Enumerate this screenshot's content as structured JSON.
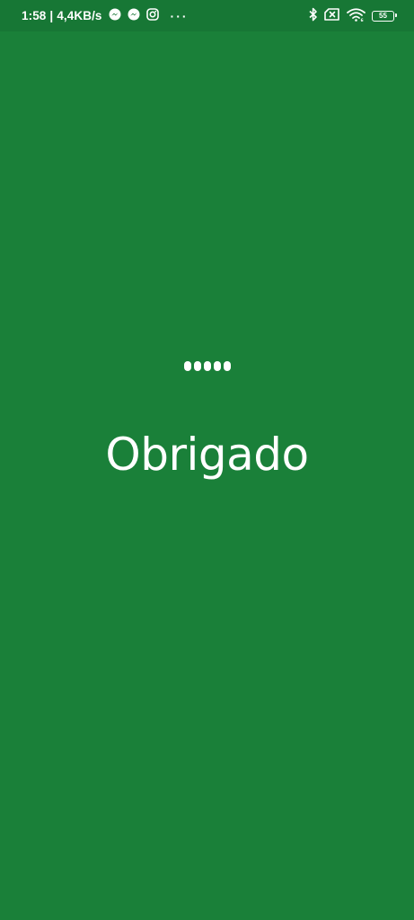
{
  "status_bar": {
    "time": "1:58",
    "separator": "|",
    "network_speed": "4,4KB/s",
    "notification_icons": [
      "messenger-icon",
      "messenger-icon",
      "instagram-icon"
    ],
    "more_notifications": "···",
    "status_icons": [
      "bluetooth-icon",
      "no-sim-icon",
      "wifi-icon"
    ],
    "battery_level": "55"
  },
  "main": {
    "pin_dots_count": 5,
    "title": "Obrigado"
  },
  "colors": {
    "background": "#1a8039",
    "status_bar_background": "#177735",
    "foreground": "#ffffff"
  }
}
